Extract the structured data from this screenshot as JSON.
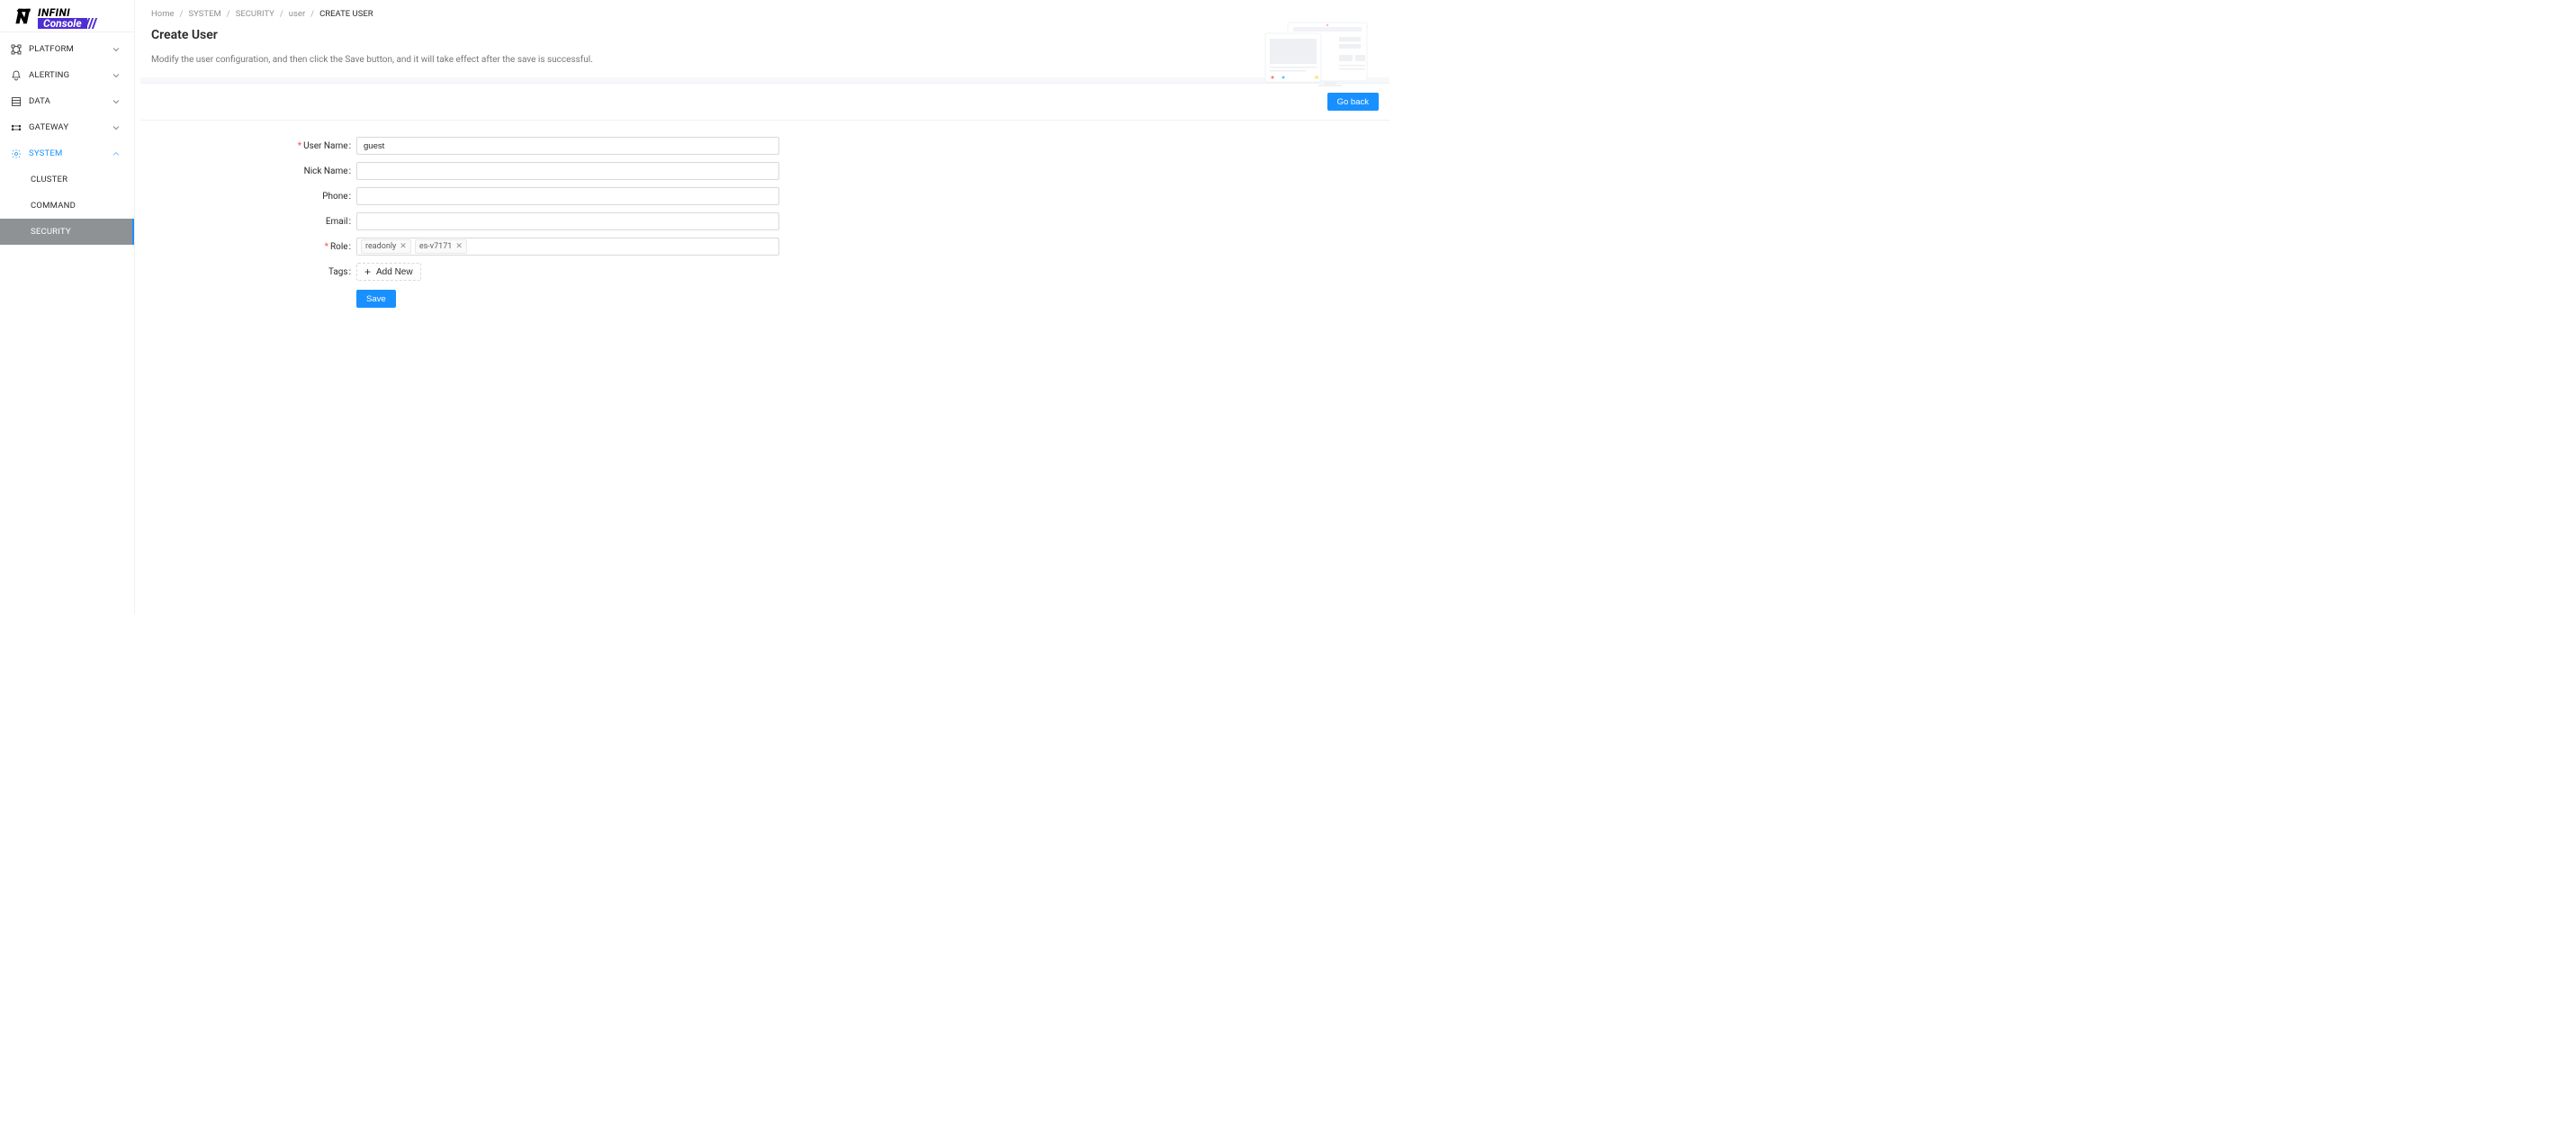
{
  "brand": {
    "line1": "INFINI",
    "line2": "Console"
  },
  "sidebar": {
    "items": [
      {
        "label": "PLATFORM",
        "icon": "platform",
        "state": "collapsed"
      },
      {
        "label": "ALERTING",
        "icon": "alerting",
        "state": "collapsed"
      },
      {
        "label": "DATA",
        "icon": "data",
        "state": "collapsed"
      },
      {
        "label": "GATEWAY",
        "icon": "gateway",
        "state": "collapsed"
      },
      {
        "label": "SYSTEM",
        "icon": "system",
        "state": "expanded",
        "children": [
          {
            "label": "CLUSTER",
            "state": "normal"
          },
          {
            "label": "COMMAND",
            "state": "normal"
          },
          {
            "label": "SECURITY",
            "state": "active"
          }
        ]
      }
    ]
  },
  "breadcrumb": {
    "items": [
      {
        "label": "Home"
      },
      {
        "label": "SYSTEM"
      },
      {
        "label": "SECURITY"
      },
      {
        "label": "user"
      },
      {
        "label": "CREATE USER",
        "current": true
      }
    ],
    "sep": "/"
  },
  "page": {
    "title": "Create User",
    "description": "Modify the user configuration, and then click the Save button, and it will take effect after the save is successful."
  },
  "actions": {
    "go_back": "Go back",
    "save": "Save",
    "add_new": "Add New"
  },
  "form": {
    "labels": {
      "user_name": "User Name",
      "nick_name": "Nick Name",
      "phone": "Phone",
      "email": "Email",
      "role": "Role",
      "tags": "Tags",
      "colon": ":"
    },
    "values": {
      "user_name": "guest",
      "nick_name": "",
      "phone": "",
      "email": "",
      "role_tags": [
        "readonly",
        "es-v7171"
      ]
    },
    "required": {
      "user_name": true,
      "role": true
    }
  }
}
